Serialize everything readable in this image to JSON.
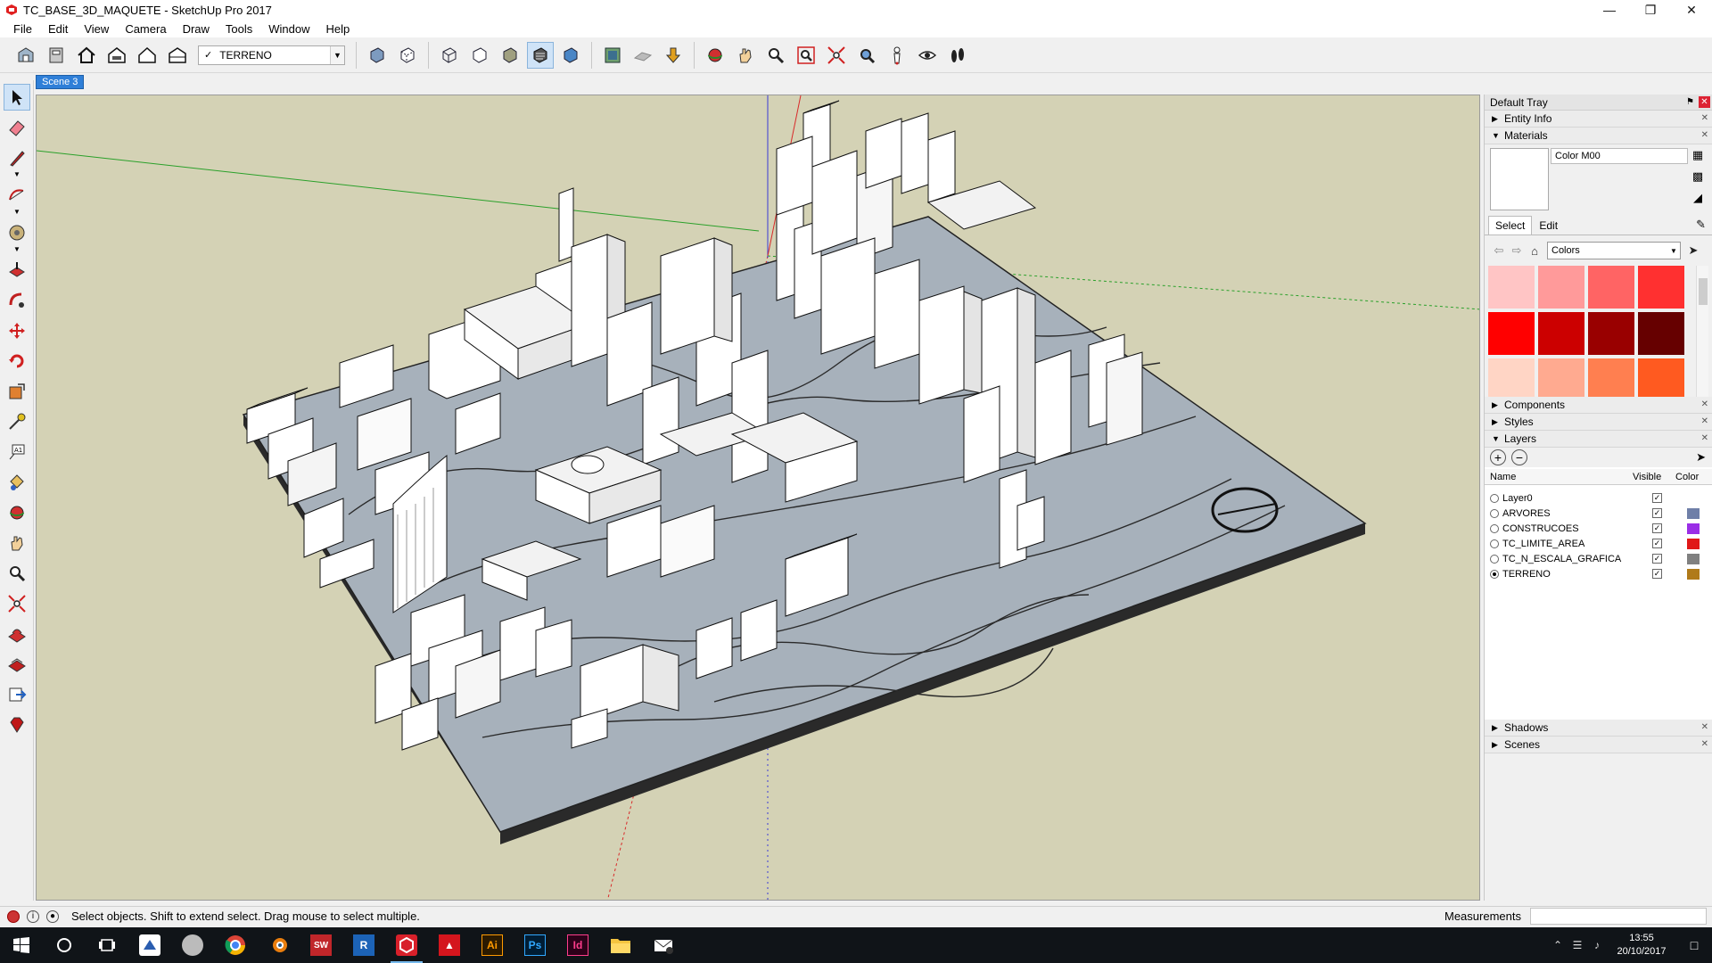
{
  "window": {
    "title": "TC_BASE_3D_MAQUETE - SketchUp Pro 2017",
    "controls": [
      "minimize",
      "maximize",
      "close"
    ]
  },
  "menu": [
    "File",
    "Edit",
    "View",
    "Camera",
    "Draw",
    "Tools",
    "Window",
    "Help"
  ],
  "toolbar": {
    "layer_select": {
      "check": "✓",
      "value": "TERRENO"
    },
    "groups": [
      [
        "warehouse-icon",
        "extension-warehouse-icon",
        "home-view-icon",
        "front-view-icon",
        "house-icon",
        "back-view-icon"
      ],
      [
        "xray-icon",
        "back-edges-icon",
        "wireframe-icon",
        "hidden-line-icon",
        "shaded-icon",
        "shaded-textures-icon",
        "monochrome-icon"
      ],
      [
        "add-location-icon",
        "toggle-terrain-icon",
        "get-models-icon"
      ],
      [
        "orbit-icon",
        "pan-icon",
        "zoom-icon",
        "zoom-window-icon",
        "zoom-extents-icon",
        "previous-view-icon",
        "position-camera-icon",
        "look-around-icon",
        "walk-icon"
      ]
    ],
    "active_style": "shaded-textures-icon"
  },
  "left_tools": [
    "select-icon",
    "eraser-icon",
    "line-icon",
    "arc-icon",
    "rotated-rect-icon",
    "push-pull-icon",
    "follow-me-icon",
    "move-icon",
    "rotate-icon",
    "scale-icon",
    "tape-measure-icon",
    "text-icon",
    "paint-bucket-icon",
    "orbit-icon",
    "pan-icon",
    "zoom-icon",
    "zoom-extents-icon",
    "sandbox-icon",
    "sandbox-drape-icon",
    "export-icon",
    "ruby-icon"
  ],
  "scene_tab": "Scene 3",
  "tray": {
    "title": "Default Tray",
    "panels": {
      "entity_info": "Entity Info",
      "materials": "Materials",
      "components": "Components",
      "styles": "Styles",
      "layers": "Layers",
      "shadows": "Shadows",
      "scenes": "Scenes"
    },
    "materials": {
      "name": "Color M00",
      "tabs": [
        "Select",
        "Edit"
      ],
      "active_tab": "Select",
      "collection": "Colors",
      "swatches": [
        "#ffc5c5",
        "#ff9a9a",
        "#ff6464",
        "#ff3030",
        "#ff0000",
        "#cc0000",
        "#990000",
        "#660000",
        "#ffd5c5",
        "#ffaa90",
        "#ff7f50",
        "#ff5a20",
        "#ff4000",
        "#cc3300",
        "#992200",
        "#661a00"
      ]
    },
    "layers": {
      "col_name": "Name",
      "col_visible": "Visible",
      "col_color": "Color",
      "rows": [
        {
          "name": "Layer0",
          "active": false,
          "visible": true,
          "color": ""
        },
        {
          "name": "ARVORES",
          "active": false,
          "visible": true,
          "color": "#6f7fa8"
        },
        {
          "name": "CONSTRUCOES",
          "active": false,
          "visible": true,
          "color": "#9a2ee6"
        },
        {
          "name": "TC_LIMITE_AREA",
          "active": false,
          "visible": true,
          "color": "#e01818"
        },
        {
          "name": "TC_N_ESCALA_GRAFICA",
          "active": false,
          "visible": true,
          "color": "#808080"
        },
        {
          "name": "TERRENO",
          "active": true,
          "visible": true,
          "color": "#b07a1a"
        }
      ]
    }
  },
  "status": {
    "message": "Select objects. Shift to extend select. Drag mouse to select multiple.",
    "measurements_label": "Measurements"
  },
  "taskbar": {
    "apps": [
      {
        "name": "start-icon",
        "label": ""
      },
      {
        "name": "cortana-icon",
        "label": ""
      },
      {
        "name": "task-view-icon",
        "label": ""
      },
      {
        "name": "app-icon",
        "label": ""
      },
      {
        "name": "sphere-app-icon",
        "label": ""
      },
      {
        "name": "chrome-icon",
        "label": ""
      },
      {
        "name": "blender-icon",
        "label": ""
      },
      {
        "name": "solidworks-icon",
        "label": ""
      },
      {
        "name": "revit-icon",
        "label": "R"
      },
      {
        "name": "sketchup-icon",
        "label": ""
      },
      {
        "name": "acrobat-icon",
        "label": ""
      },
      {
        "name": "illustrator-icon",
        "label": "Ai"
      },
      {
        "name": "photoshop-icon",
        "label": "Ps"
      },
      {
        "name": "indesign-icon",
        "label": "Id"
      },
      {
        "name": "file-explorer-icon",
        "label": ""
      },
      {
        "name": "mail-icon",
        "label": ""
      }
    ],
    "active_app": "sketchup-icon",
    "time": "13:55",
    "date": "20/10/2017"
  }
}
